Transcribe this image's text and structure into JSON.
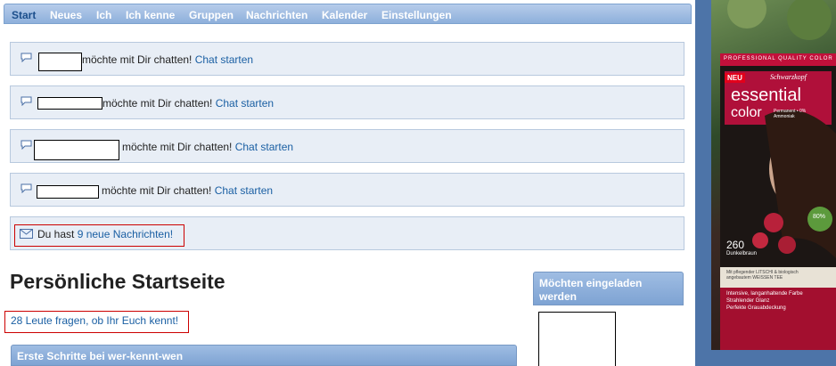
{
  "nav": {
    "items": [
      "Start",
      "Neues",
      "Ich",
      "Ich kenne",
      "Gruppen",
      "Nachrichten",
      "Kalender",
      "Einstellungen"
    ],
    "active": "Start"
  },
  "chat_notices": [
    {
      "text": "möchte mit Dir chatten!",
      "link": "Chat starten"
    },
    {
      "text": "möchte mit Dir chatten!",
      "link": "Chat starten"
    },
    {
      "text": "möchte mit Dir chatten!",
      "link": "Chat starten"
    },
    {
      "text": "möchte mit Dir chatten!",
      "link": "Chat starten"
    }
  ],
  "messages": {
    "prefix": "Du hast",
    "link": "9 neue Nachrichten!"
  },
  "page_title": "Persönliche Startseite",
  "people_link": "28 Leute fragen, ob Ihr Euch kennt!",
  "first_steps": "Erste Schritte bei wer-kennt-wen",
  "invite": {
    "header": "Möchten eingeladen werden"
  },
  "ad": {
    "top_text": "PROFESSIONAL QUALITY COLOR",
    "badge": "NEU",
    "brand": "Schwarzkopf",
    "product": "essential",
    "product2": "color",
    "sub": "Permanent • 0% Ammoniak",
    "shade_number": "260",
    "shade_name": "Dunkelbraun",
    "blurb": "Mit pflegender LITSCHI & biologisch angebautem WEISSEN TEE",
    "bottom_lines": [
      "Intensive, langanhaltende Farbe",
      "Strahlender Glanz",
      "Perfekte Grauabdeckung"
    ],
    "seal": "80%"
  }
}
